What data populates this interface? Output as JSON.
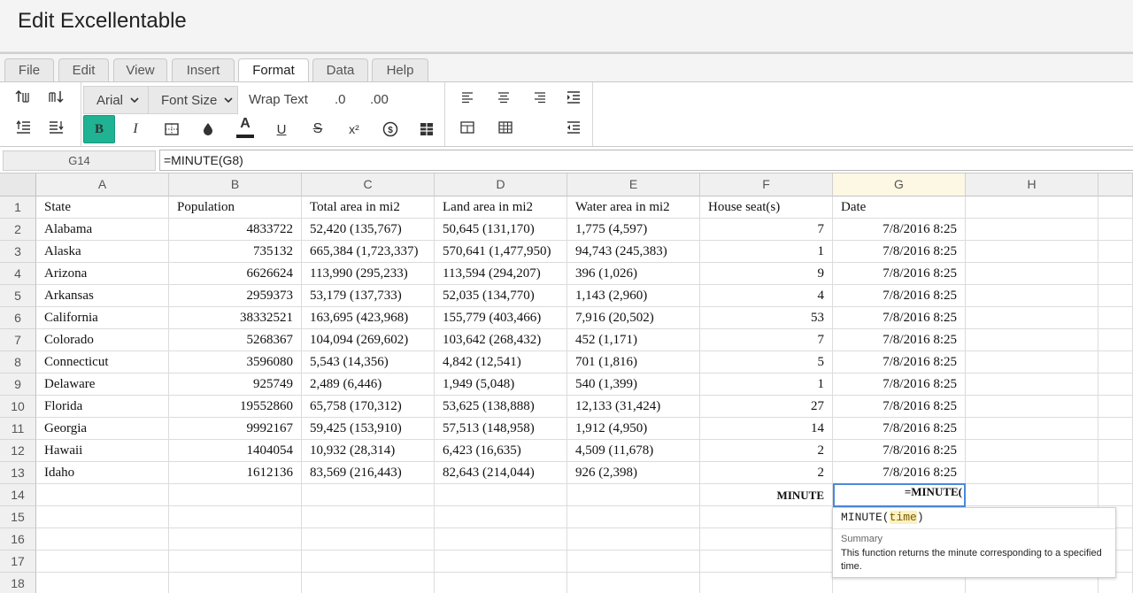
{
  "app": {
    "title": "Edit Excellentable"
  },
  "menu": {
    "tabs": [
      "File",
      "Edit",
      "View",
      "Insert",
      "Format",
      "Data",
      "Help"
    ],
    "active": "Format"
  },
  "toolbar": {
    "font_name": "Arial",
    "font_size": "Font Size",
    "wrap_text": "Wrap Text",
    "decrease_decimal": ".0",
    "increase_decimal": ".00",
    "bold": "B",
    "italic": "I",
    "text_color_letter": "A",
    "underline": "U",
    "strike": "S",
    "superscript": "x²",
    "accent_color": "#1fb393",
    "text_color_bar": "#222222"
  },
  "formula_bar": {
    "cell_ref": "G14",
    "formula": "=MINUTE(G8)"
  },
  "sheet": {
    "columns": [
      "A",
      "B",
      "C",
      "D",
      "E",
      "F",
      "G",
      "H"
    ],
    "selected_column": "G",
    "row_numbers": [
      "1",
      "2",
      "3",
      "4",
      "5",
      "6",
      "7",
      "8",
      "9",
      "10",
      "11",
      "12",
      "13",
      "14",
      "15",
      "16",
      "17",
      "18"
    ],
    "rows": [
      [
        "State",
        "Population",
        "Total area in mi2",
        "Land area in mi2",
        "Water area in mi2",
        "House seat(s)",
        "Date",
        ""
      ],
      [
        "Alabama",
        "4833722",
        "52,420 (135,767)",
        "50,645 (131,170)",
        "1,775 (4,597)",
        "7",
        "7/8/2016 8:25",
        ""
      ],
      [
        "Alaska",
        "735132",
        "665,384 (1,723,337)",
        "570,641 (1,477,950)",
        "94,743 (245,383)",
        "1",
        "7/8/2016 8:25",
        ""
      ],
      [
        "Arizona",
        "6626624",
        "113,990 (295,233)",
        "113,594 (294,207)",
        "396 (1,026)",
        "9",
        "7/8/2016 8:25",
        ""
      ],
      [
        "Arkansas",
        "2959373",
        "53,179 (137,733)",
        "52,035 (134,770)",
        "1,143 (2,960)",
        "4",
        "7/8/2016 8:25",
        ""
      ],
      [
        "California",
        "38332521",
        "163,695 (423,968)",
        "155,779 (403,466)",
        "7,916 (20,502)",
        "53",
        "7/8/2016 8:25",
        ""
      ],
      [
        "Colorado",
        "5268367",
        "104,094 (269,602)",
        "103,642 (268,432)",
        "452 (1,171)",
        "7",
        "7/8/2016 8:25",
        ""
      ],
      [
        "Connecticut",
        "3596080",
        "5,543 (14,356)",
        "4,842 (12,541)",
        "701 (1,816)",
        "5",
        "7/8/2016 8:25",
        ""
      ],
      [
        "Delaware",
        "925749",
        "2,489 (6,446)",
        "1,949 (5,048)",
        "540 (1,399)",
        "1",
        "7/8/2016 8:25",
        ""
      ],
      [
        "Florida",
        "19552860",
        "65,758 (170,312)",
        "53,625 (138,888)",
        "12,133 (31,424)",
        "27",
        "7/8/2016 8:25",
        ""
      ],
      [
        "Georgia",
        "9992167",
        "59,425 (153,910)",
        "57,513 (148,958)",
        "1,912 (4,950)",
        "14",
        "7/8/2016 8:25",
        ""
      ],
      [
        "Hawaii",
        "1404054",
        "10,932 (28,314)",
        "6,423 (16,635)",
        "4,509 (11,678)",
        "2",
        "7/8/2016 8:25",
        ""
      ],
      [
        "Idaho",
        "1612136",
        "83,569 (216,443)",
        "82,643 (214,044)",
        "926 (2,398)",
        "2",
        "7/8/2016 8:25",
        ""
      ],
      [
        "",
        "",
        "",
        "",
        "",
        "MINUTE",
        "=MINUTE(",
        ""
      ],
      [
        "",
        "",
        "",
        "",
        "",
        "",
        "",
        ""
      ],
      [
        "",
        "",
        "",
        "",
        "",
        "",
        "",
        ""
      ],
      [
        "",
        "",
        "",
        "",
        "",
        "",
        "",
        ""
      ],
      [
        "",
        "",
        "",
        "",
        "",
        "",
        "",
        ""
      ]
    ]
  },
  "autocomplete": {
    "function_name": "MINUTE(",
    "argument": "time",
    "closing": ")",
    "summary_title": "Summary",
    "summary_text": "This function returns the minute corresponding to a specified time."
  }
}
